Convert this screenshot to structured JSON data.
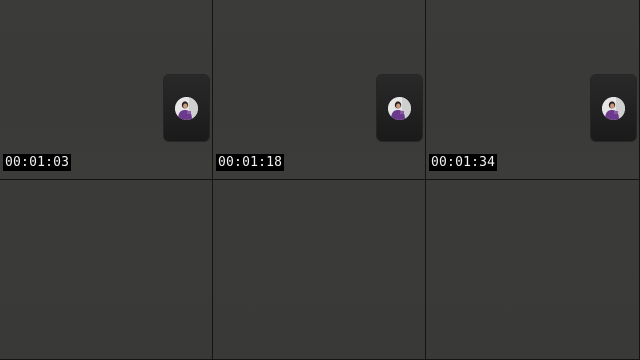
{
  "tiles": [
    {
      "timestamp": "00:01:03"
    },
    {
      "timestamp": "00:01:18"
    },
    {
      "timestamp": "00:01:34"
    }
  ],
  "icons": {
    "thumbnail": "participant-avatar"
  },
  "colors": {
    "tile_background": "#3a3a38",
    "card_background": "#222121",
    "timestamp_background": "#000000",
    "timestamp_text": "#f2f2f2",
    "avatar_clothing": "#6b3a8c"
  }
}
